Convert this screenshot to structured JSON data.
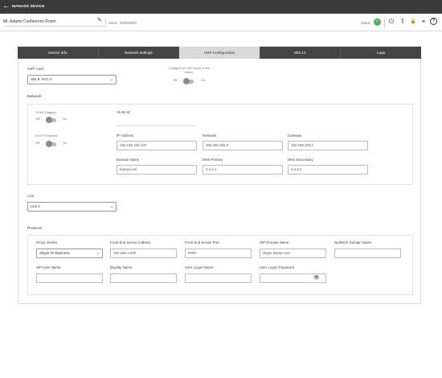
{
  "header": {
    "back_icon": "arrow-left-icon",
    "back_glyph": "←",
    "title": "MANAGE DEVICE"
  },
  "device": {
    "name": "Mt. Adams Conference Room",
    "edit_icon": "pencil-icon",
    "edit_glyph": "✎",
    "serial_label": "Serial",
    "serial_value": "#00090962",
    "status_label": "Status",
    "status_glyph": "✓",
    "status_color": "#4caf50"
  },
  "toolbar": {
    "power_glyph": "⏻",
    "upload_glyph": "⇪",
    "lock_glyph": "🔒",
    "location_glyph": "⌖",
    "help_glyph": "?"
  },
  "tabs": [
    {
      "label": "Device Info",
      "active": false
    },
    {
      "label": "Network Settings",
      "active": false
    },
    {
      "label": "VoIP Configuration",
      "active": true
    },
    {
      "label": "802.1X",
      "active": false
    },
    {
      "label": "Logs",
      "active": false
    }
  ],
  "voip": {
    "card_label": "VoIP Card",
    "card_value": "Slot 9: SVC-2",
    "configure_all_label": "Configure all VoIP cards in this device",
    "off": "Off",
    "on": "On"
  },
  "network": {
    "title": "Network",
    "vlan_tagging_label": "VLAN Tagging",
    "dhcp_label": "DHCP Enabled",
    "vlan_id_label": "VLAN ID",
    "vlan_id_value": "",
    "ip_label": "IP Address",
    "ip_value": "192.168.100.103",
    "netmask_label": "Netmask",
    "netmask_value": "255.255.255.0",
    "gateway_label": "Gateway",
    "gateway_value": "192.168.100.1",
    "domain_label": "Domain Name",
    "domain_value": "biamp.com",
    "dns1_label": "DNS Primary",
    "dns1_value": "4.4.4.1",
    "dns2_label": "DNS Secondary",
    "dns2_value": "4.4.4.2"
  },
  "line": {
    "label": "Line",
    "value": "Line 1"
  },
  "protocol": {
    "title": "Protocol",
    "proxy_vendor_label": "Proxy Vendor",
    "proxy_vendor_value": "Skype for Business",
    "fe_address_label": "Front End Server Address",
    "fe_address_value": "192.168.1.200",
    "fe_port_label": "Front End Server Port",
    "fe_port_value": "5063",
    "sip_domain_label": "SIP Domain Name",
    "sip_domain_value": "skype.biamp.com",
    "netbios_label": "NetBIOS Domain Name",
    "netbios_value": "",
    "sip_user_label": "SIP User Name",
    "sip_user_value": "",
    "display_name_label": "Display Name",
    "display_name_value": "",
    "logon_name_label": "User Logon Name",
    "logon_name_value": "",
    "logon_password_label": "User Logon Password",
    "logon_password_value": "",
    "eye_glyph": "👁"
  },
  "chevron_glyph": "⌄"
}
